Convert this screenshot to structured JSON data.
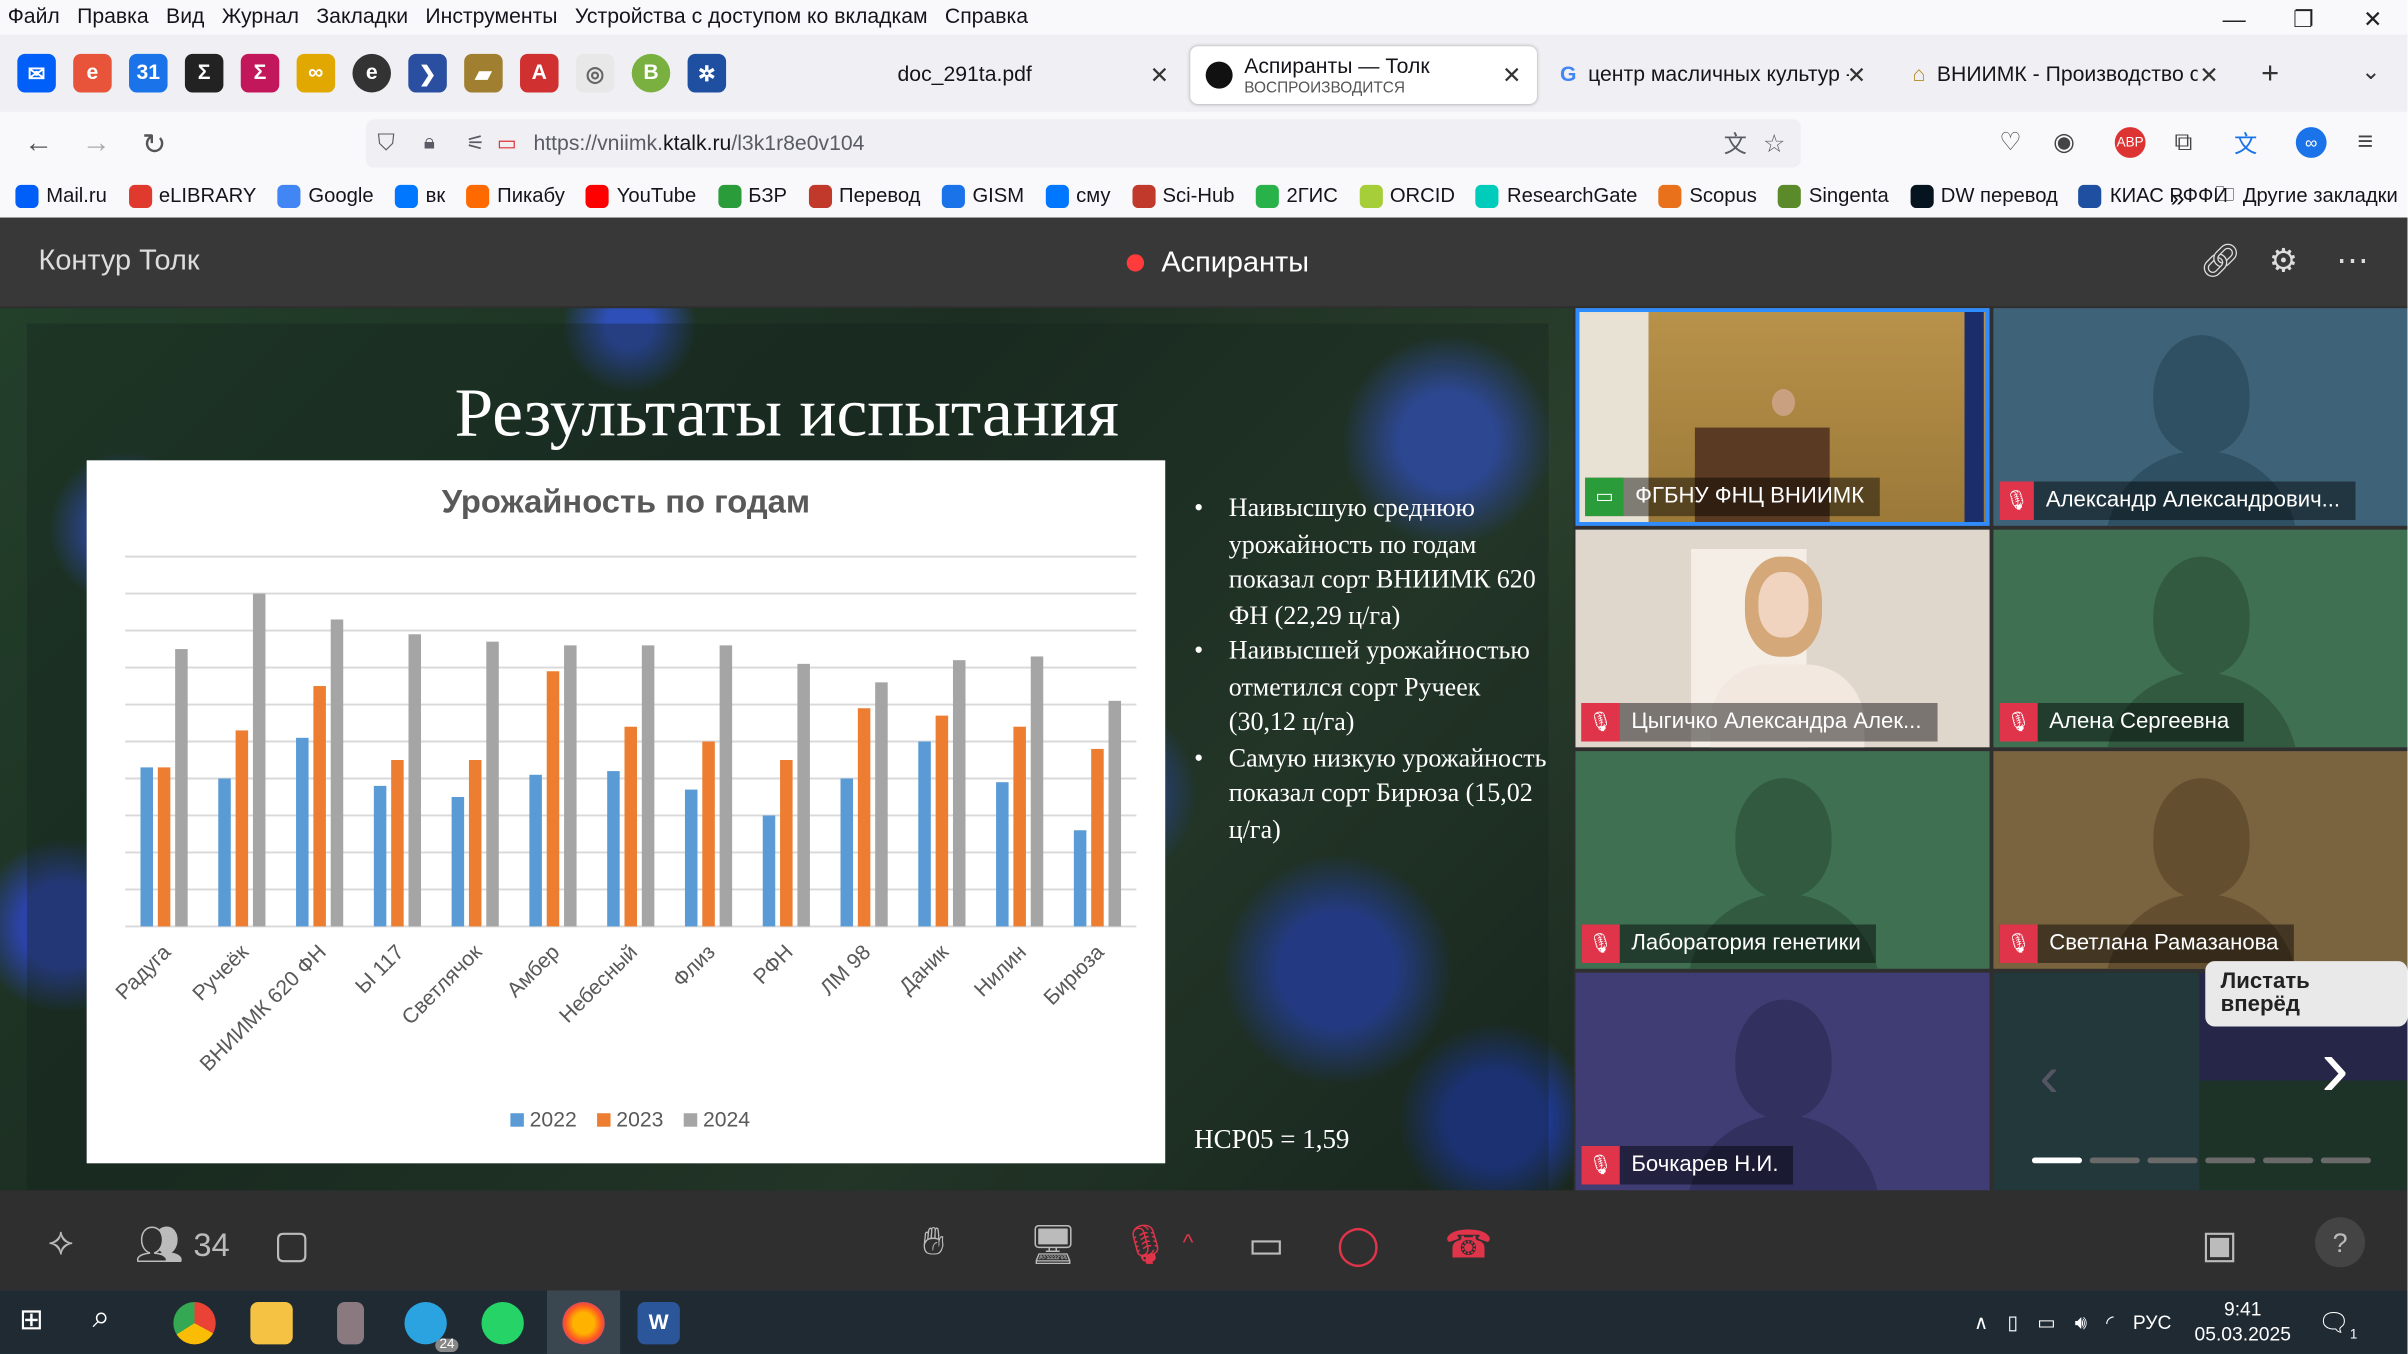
{
  "menu": [
    "Файл",
    "Правка",
    "Вид",
    "Журнал",
    "Закладки",
    "Инструменты",
    "Устройства с доступом ко вкладкам",
    "Справка"
  ],
  "tabs": [
    {
      "label": "doc_291ta.pdf"
    },
    {
      "label": "Аспиранты — Толк",
      "sub": "ВОСПРОИЗВОДИТСЯ"
    },
    {
      "label": "центр масличных культур - По"
    },
    {
      "label": "ВНИИМК - Производство семя"
    }
  ],
  "url": {
    "prefix": "https://vniimk.",
    "domain": "ktalk.ru",
    "path": "/l3k1r8e0v104"
  },
  "bookmarks": [
    {
      "label": "Mail.ru",
      "color": "#005ff9"
    },
    {
      "label": "eLIBRARY",
      "color": "#e03a2f"
    },
    {
      "label": "Google",
      "color": "#4285f4"
    },
    {
      "label": "вк",
      "color": "#0077ff"
    },
    {
      "label": "Пикабу",
      "color": "#ff6a00"
    },
    {
      "label": "YouTube",
      "color": "#ff0000"
    },
    {
      "label": "БЗР",
      "color": "#2a9d3a"
    },
    {
      "label": "Перевод",
      "color": "#c0392b"
    },
    {
      "label": "GISM",
      "color": "#1a73e8"
    },
    {
      "label": "сму",
      "color": "#0077ff"
    },
    {
      "label": "Sci-Hub",
      "color": "#c0392b"
    },
    {
      "label": "2ГИС",
      "color": "#29b24a"
    },
    {
      "label": "ORCID",
      "color": "#a6ce39"
    },
    {
      "label": "ResearchGate",
      "color": "#00ccbb"
    },
    {
      "label": "Scopus",
      "color": "#e9711c"
    },
    {
      "label": "Singenta",
      "color": "#5a8a2a"
    },
    {
      "label": "DW перевод",
      "color": "#05141f"
    },
    {
      "label": "КИАС РФФИ",
      "color": "#1e4fa1"
    }
  ],
  "bookmarks_other": "Другие закладки",
  "app": {
    "name": "Контур Толк",
    "room": "Аспиранты"
  },
  "slide": {
    "title": "Результаты испытания",
    "bullets": [
      "Наивысшую среднюю урожайность по годам показал сорт ВНИИМК 620 ФН (22,29 ц/га)",
      "Наивысшей урожайностью отметился сорт Ручеек (30,12 ц/га)",
      "Самую низкую урожайность показал сорт Бирюза (15,02 ц/га)"
    ],
    "nsr": "НСР05 = 1,59"
  },
  "chart_data": {
    "type": "bar",
    "title": "Урожайность по годам",
    "categories": [
      "Радуга",
      "Ручеёк",
      "ВНИИМК 620 ФН",
      "Ы 117",
      "Светлячок",
      "Амбер",
      "Небесный",
      "Флиз",
      "РФН",
      "ЛМ 98",
      "Даник",
      "Нилин",
      "Бирюза"
    ],
    "series": [
      {
        "name": "2022",
        "color": "#5b9bd5",
        "values": [
          21.5,
          20.0,
          25.5,
          19.0,
          17.5,
          20.5,
          21.0,
          18.5,
          15.0,
          20.0,
          25.0,
          19.5,
          13.0
        ]
      },
      {
        "name": "2023",
        "color": "#ed7d31",
        "values": [
          21.5,
          26.5,
          32.5,
          22.5,
          22.5,
          34.5,
          27.0,
          25.0,
          22.5,
          29.5,
          28.5,
          27.0,
          24.0
        ]
      },
      {
        "name": "2024",
        "color": "#a5a5a5",
        "values": [
          37.5,
          45.0,
          41.5,
          39.5,
          38.5,
          38.0,
          38.0,
          38.0,
          35.5,
          33.0,
          36.0,
          36.5,
          30.5
        ]
      }
    ],
    "ylim": [
      0,
      50
    ],
    "grid": true,
    "legend": "bottom"
  },
  "participants": [
    {
      "name": "ФГБНУ ФНЦ ВНИИМК",
      "kind": "video-speaker",
      "bg": "#8a6a3a"
    },
    {
      "name": "Александр Александрович...",
      "kind": "silhouette",
      "bg": "#3e6378",
      "fg": "#2f5062"
    },
    {
      "name": "Цыгичко Александра Алек...",
      "kind": "video-woman",
      "bg": "#d8d0c8"
    },
    {
      "name": "Алена Сергеевна",
      "kind": "silhouette",
      "bg": "#3f7052",
      "fg": "#315a41"
    },
    {
      "name": "Лаборатория генетики",
      "kind": "silhouette",
      "bg": "#3f7052",
      "fg": "#315a41"
    },
    {
      "name": "Светлана Рамазанова",
      "kind": "silhouette",
      "bg": "#7a6440",
      "fg": "#634f30"
    },
    {
      "name": "Бочкарев Н.И.",
      "kind": "silhouette",
      "bg": "#3f3d73",
      "fg": "#32305e"
    }
  ],
  "tooltip": "Листать вперёд",
  "controls": {
    "participants_count": "34"
  },
  "taskbar": {
    "time": "9:41",
    "date": "05.03.2025",
    "lang": "РУС",
    "notify": "1",
    "telegram_badge": "24"
  }
}
